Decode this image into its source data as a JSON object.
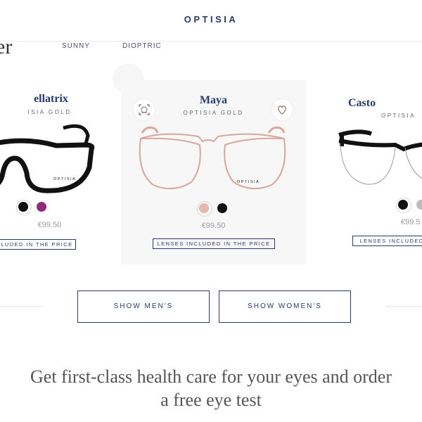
{
  "header": {
    "logo": "OPTISIA"
  },
  "filter": {
    "title_fragment": "er",
    "tabs": [
      {
        "label": "SUNNY"
      },
      {
        "label": "DIOPTRIC"
      }
    ]
  },
  "products": [
    {
      "name": "ellatrix",
      "brand": "ISIA GOLD",
      "frame_brand": "OPTISIA",
      "price": "€99.50",
      "lenses": "CLUDED IN THE PRICE",
      "swatches": [
        "#111111",
        "#8d2b7d"
      ],
      "frame_color": "#111111"
    },
    {
      "name": "Maya",
      "brand": "OPTISIA GOLD",
      "frame_brand": "OPTISIA",
      "price": "€99.50",
      "lenses": "LENSES INCLUDED IN THE PRICE",
      "swatches": [
        "#e6b9aa",
        "#111111"
      ],
      "frame_color": "#d7a79a"
    },
    {
      "name": "Casto",
      "brand": "OPTISIA",
      "price": "€99.5",
      "lenses": "LENSES INCLUDED",
      "swatches": [
        "#111111",
        "#bcbcbc"
      ],
      "frame_color": "#111111"
    }
  ],
  "actions": {
    "men": "SHOW MEN'S",
    "women": "SHOW WOMEN'S"
  },
  "cta": {
    "line1": "Get first-class health care for your eyes and order",
    "line2": "a free eye test"
  }
}
